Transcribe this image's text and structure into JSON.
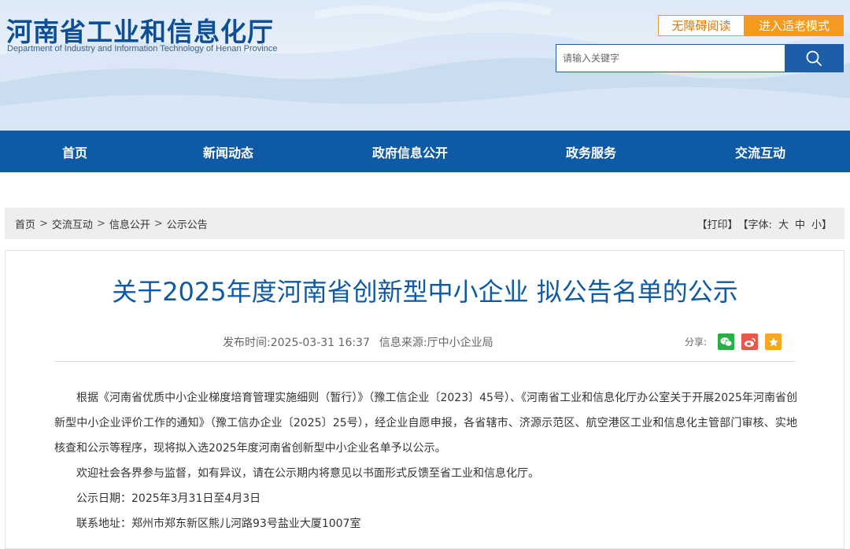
{
  "header": {
    "title": "河南省工业和信息化厅",
    "subtitle": "Department of Industry and Information Technology of Henan Province",
    "barrier_free_label": "无障碍阅读",
    "elder_mode_label": "进入适老模式",
    "search_placeholder": "请输入关键字"
  },
  "nav": {
    "items": [
      {
        "label": "首页"
      },
      {
        "label": "新闻动态"
      },
      {
        "label": "政府信息公开"
      },
      {
        "label": "政务服务"
      },
      {
        "label": "交流互动"
      }
    ]
  },
  "breadcrumb": {
    "items": [
      "首页",
      "交流互动",
      "信息公开",
      "公示公告"
    ],
    "separator": ">"
  },
  "tools": {
    "print_label": "【打印】",
    "font_label": "【字体:",
    "large": "大",
    "medium": "中",
    "small": "小",
    "close_bracket": "】"
  },
  "article": {
    "title": "关于2025年度河南省创新型中小企业 拟公告名单的公示",
    "publish_label": "发布时间:",
    "publish_time": "2025-03-31 16:37",
    "source_label": "信息来源:",
    "source": "厅中小企业局",
    "share_label": "分享:",
    "paragraphs": [
      "根据《河南省优质中小企业梯度培育管理实施细则（暂行）》（豫工信企业〔2023〕45号）、《河南省工业和信息化厅办公室关于开展2025年河南省创新型中小企业评价工作的通知》（豫工信办企业〔2025〕25号），经企业自愿申报，各省辖市、济源示范区、航空港区工业和信息化主管部门审核、实地核查和公示等程序，现将拟入选2025年度河南省创新型中小企业名单予以公示。",
      "欢迎社会各界参与监督，如有异议，请在公示期内将意见以书面形式反馈至省工业和信息化厅。",
      "公示日期：2025年3月31日至4月3日",
      "联系地址：郑州市郑东新区熊儿河路93号盐业大厦1007室"
    ]
  },
  "colors": {
    "brand_blue": "#0f5aa5",
    "accent_orange": "#f39a1f",
    "wechat_green": "#2aae45",
    "weibo_red": "#e8574a",
    "favorite_yellow": "#f5a623"
  },
  "icons": {
    "search": "search-icon",
    "wechat": "wechat-icon",
    "weibo": "weibo-icon",
    "favorite": "star-icon"
  }
}
